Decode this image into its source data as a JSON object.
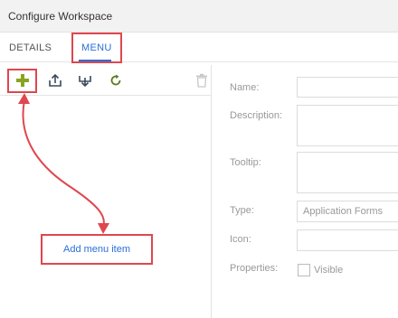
{
  "window": {
    "title": "Configure Workspace"
  },
  "tabs": [
    {
      "label": "DETAILS",
      "active": false
    },
    {
      "label": "MENU",
      "active": true
    }
  ],
  "toolbar": {
    "buttons": [
      {
        "icon": "plus-icon",
        "color": "#8aa31f"
      },
      {
        "icon": "export-icon",
        "color": "#3a4a5c"
      },
      {
        "icon": "import-icon",
        "color": "#3a4a5c"
      },
      {
        "icon": "refresh-icon",
        "color": "#5a7a1c"
      },
      {
        "icon": "trash-icon",
        "color": "#c8c8c8"
      }
    ]
  },
  "callout": {
    "text": "Add menu item"
  },
  "form": {
    "name_label": "Name:",
    "description_label": "Description:",
    "tooltip_label": "Tooltip:",
    "type_label": "Type:",
    "type_value": "Application Forms",
    "icon_label": "Icon:",
    "properties_label": "Properties:",
    "visible_label": "Visible"
  },
  "colors": {
    "accent": "#2a6fd8",
    "highlight": "#e0464e"
  }
}
